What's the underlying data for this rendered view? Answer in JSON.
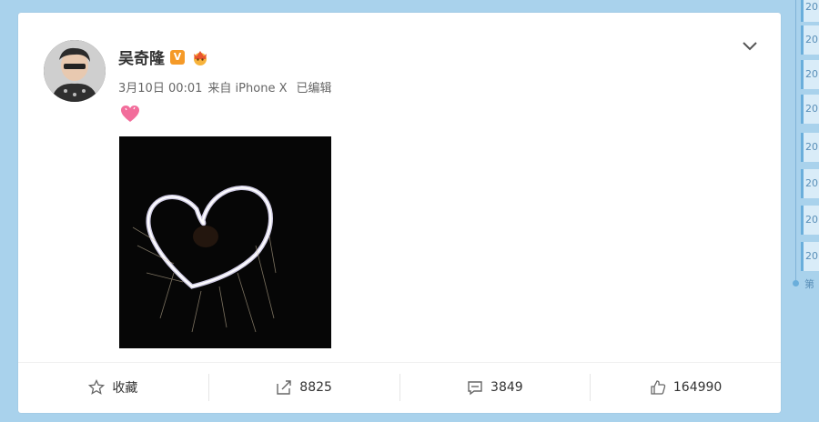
{
  "post": {
    "author": "吴奇隆",
    "date": "3月10日 00:01",
    "source": "来自 iPhone X",
    "edited": "已编辑",
    "verified_badge": "V"
  },
  "actions": {
    "favorite_label": "收藏",
    "repost_count": "8825",
    "comment_count": "3849",
    "like_count": "164990"
  },
  "timeline": {
    "items": [
      "20",
      "20",
      "20",
      "20",
      "20",
      "20",
      "20",
      "20"
    ],
    "last": "第"
  },
  "icons": {
    "more": "chevron-down-icon",
    "favorite": "star-icon",
    "repost": "share-icon",
    "comment": "comment-icon",
    "like": "thumbs-up-icon"
  },
  "colors": {
    "background": "#a9d2ec",
    "badge_orange": "#f59a28",
    "timeline_accent": "#6aaedb"
  }
}
